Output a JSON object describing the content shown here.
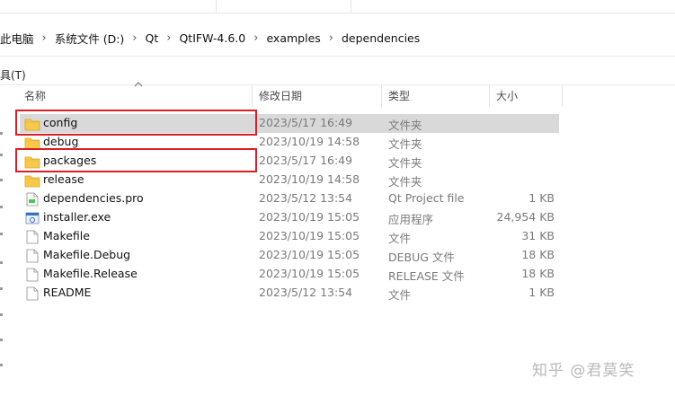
{
  "breadcrumb": [
    "此电脑",
    "系统文件 (D:)",
    "Qt",
    "QtIFW-4.6.0",
    "examples",
    "dependencies"
  ],
  "menubar": {
    "tools_label": "具(T)"
  },
  "columns": {
    "name": "名称",
    "date": "修改日期",
    "type": "类型",
    "size": "大小"
  },
  "files": [
    {
      "name": "config",
      "date": "2023/5/17 16:49",
      "type": "文件夹",
      "size": "",
      "icon": "folder-icon",
      "selected": true,
      "highlighted": true
    },
    {
      "name": "debug",
      "date": "2023/10/19 14:58",
      "type": "文件夹",
      "size": "",
      "icon": "folder-icon",
      "selected": false,
      "highlighted": false
    },
    {
      "name": "packages",
      "date": "2023/5/17 16:49",
      "type": "文件夹",
      "size": "",
      "icon": "folder-icon",
      "selected": false,
      "highlighted": true
    },
    {
      "name": "release",
      "date": "2023/10/19 14:58",
      "type": "文件夹",
      "size": "",
      "icon": "folder-icon",
      "selected": false,
      "highlighted": false
    },
    {
      "name": "dependencies.pro",
      "date": "2023/5/12 13:54",
      "type": "Qt Project file",
      "size": "1 KB",
      "icon": "pro-file-icon",
      "selected": false,
      "highlighted": false
    },
    {
      "name": "installer.exe",
      "date": "2023/10/19 15:05",
      "type": "应用程序",
      "size": "24,954 KB",
      "icon": "exe-icon",
      "selected": false,
      "highlighted": false
    },
    {
      "name": "Makefile",
      "date": "2023/10/19 15:05",
      "type": "文件",
      "size": "31 KB",
      "icon": "file-icon",
      "selected": false,
      "highlighted": false
    },
    {
      "name": "Makefile.Debug",
      "date": "2023/10/19 15:05",
      "type": "DEBUG 文件",
      "size": "18 KB",
      "icon": "file-icon",
      "selected": false,
      "highlighted": false
    },
    {
      "name": "Makefile.Release",
      "date": "2023/10/19 15:05",
      "type": "RELEASE 文件",
      "size": "18 KB",
      "icon": "file-icon",
      "selected": false,
      "highlighted": false
    },
    {
      "name": "README",
      "date": "2023/5/12 13:54",
      "type": "文件",
      "size": "1 KB",
      "icon": "file-icon",
      "selected": false,
      "highlighted": false
    }
  ],
  "watermark": "知乎 @君莫笑",
  "colors": {
    "highlight_border": "#d81f26",
    "selected_row": "#d9d9d9",
    "folder": "#f6c94c"
  }
}
